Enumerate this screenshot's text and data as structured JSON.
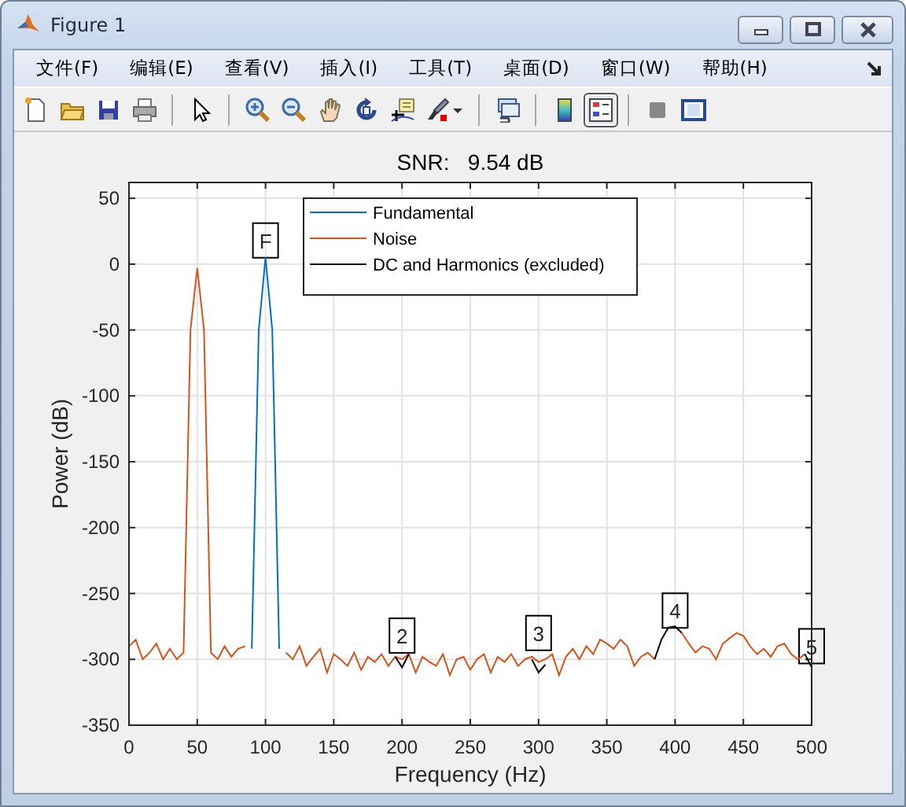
{
  "window": {
    "title": "Figure 1"
  },
  "menu": [
    {
      "label": "文件(F)"
    },
    {
      "label": "编辑(E)"
    },
    {
      "label": "查看(V)"
    },
    {
      "label": "插入(I)"
    },
    {
      "label": "工具(T)"
    },
    {
      "label": "桌面(D)"
    },
    {
      "label": "窗口(W)"
    },
    {
      "label": "帮助(H)"
    }
  ],
  "toolbar": [
    [
      {
        "kind": "new",
        "selected": false
      },
      {
        "kind": "open",
        "selected": false
      },
      {
        "kind": "save",
        "selected": false
      },
      {
        "kind": "print",
        "selected": false
      }
    ],
    [
      {
        "kind": "pointer",
        "selected": false
      }
    ],
    [
      {
        "kind": "zoom-in",
        "selected": false
      },
      {
        "kind": "zoom-out",
        "selected": false
      },
      {
        "kind": "pan",
        "selected": false
      },
      {
        "kind": "rotate",
        "selected": false
      },
      {
        "kind": "datatip",
        "selected": false
      },
      {
        "kind": "brush",
        "selected": false
      }
    ],
    [
      {
        "kind": "link",
        "selected": false
      }
    ],
    [
      {
        "kind": "colorbar",
        "selected": false
      },
      {
        "kind": "legend",
        "selected": true
      }
    ],
    [
      {
        "kind": "hide",
        "selected": false
      },
      {
        "kind": "dock",
        "selected": false
      }
    ]
  ],
  "chart_data": {
    "type": "line",
    "title": "SNR:   9.54 dB",
    "xlabel": "Frequency (Hz)",
    "ylabel": "Power (dB)",
    "xlim": [
      0,
      500
    ],
    "ylim": [
      -350,
      62
    ],
    "grid": true,
    "legend": true,
    "xticks": [
      0,
      50,
      100,
      150,
      200,
      250,
      300,
      350,
      400,
      450,
      500
    ],
    "yticks": [
      -350,
      -300,
      -250,
      -200,
      -150,
      -100,
      -50,
      0,
      50
    ],
    "x": [
      0,
      5,
      10,
      15,
      20,
      25,
      30,
      35,
      40,
      45,
      50,
      55,
      60,
      65,
      70,
      75,
      80,
      85,
      90,
      95,
      100,
      105,
      110,
      115,
      120,
      125,
      130,
      135,
      140,
      145,
      150,
      155,
      160,
      165,
      170,
      175,
      180,
      185,
      190,
      195,
      200,
      205,
      210,
      215,
      220,
      225,
      230,
      235,
      240,
      245,
      250,
      255,
      260,
      265,
      270,
      275,
      280,
      285,
      290,
      295,
      300,
      305,
      310,
      315,
      320,
      325,
      330,
      335,
      340,
      345,
      350,
      355,
      360,
      365,
      370,
      375,
      380,
      385,
      390,
      395,
      400,
      405,
      410,
      415,
      420,
      425,
      430,
      435,
      440,
      445,
      450,
      455,
      460,
      465,
      470,
      475,
      480,
      485,
      490,
      495,
      500
    ],
    "series": [
      {
        "name": "Fundamental",
        "color": "#0072bd",
        "values": [
          null,
          null,
          null,
          null,
          null,
          null,
          null,
          null,
          null,
          null,
          null,
          null,
          null,
          null,
          null,
          null,
          null,
          null,
          -292,
          -50,
          5,
          -50,
          -292,
          null,
          null,
          null,
          null,
          null,
          null,
          null,
          null,
          null,
          null,
          null,
          null,
          null,
          null,
          null,
          null,
          null,
          null,
          null,
          null,
          null,
          null,
          null,
          null,
          null,
          null,
          null,
          null,
          null,
          null,
          null,
          null,
          null,
          null,
          null,
          null,
          null,
          null,
          null,
          null,
          null,
          null,
          null,
          null,
          null,
          null,
          null,
          null,
          null,
          null,
          null,
          null,
          null,
          null,
          null,
          null,
          null,
          null,
          null,
          null,
          null,
          null,
          null,
          null,
          null,
          null,
          null,
          null,
          null,
          null,
          null,
          null,
          null,
          null,
          null,
          null,
          null,
          null
        ]
      },
      {
        "name": "Noise",
        "color": "#d95319",
        "values": [
          -290,
          -285,
          -300,
          -295,
          -288,
          -300,
          -292,
          -300,
          -295,
          -50,
          -3,
          -50,
          -295,
          -300,
          -290,
          -298,
          -292,
          -290,
          null,
          null,
          null,
          null,
          null,
          -295,
          -300,
          -290,
          -305,
          -298,
          -292,
          -310,
          -296,
          -300,
          -305,
          -295,
          -308,
          -298,
          -302,
          -296,
          -305,
          -298,
          -300,
          -296,
          -310,
          -298,
          -302,
          -305,
          -296,
          -312,
          -300,
          -298,
          -308,
          -300,
          -296,
          -310,
          -298,
          -302,
          -296,
          -305,
          -300,
          -298,
          -302,
          -300,
          -296,
          -312,
          -298,
          -292,
          -300,
          -290,
          -296,
          -285,
          -288,
          -292,
          -285,
          -290,
          -305,
          -298,
          -295,
          -300,
          null,
          null,
          null,
          -280,
          -288,
          -295,
          -290,
          -292,
          -300,
          -288,
          -284,
          -280,
          -282,
          -290,
          -296,
          -292,
          -298,
          -290,
          -288,
          -296,
          -300,
          -296,
          null
        ]
      },
      {
        "name": "DC and Harmonics (excluded)",
        "color": "#000000",
        "values": [
          null,
          null,
          null,
          null,
          null,
          null,
          null,
          null,
          null,
          null,
          null,
          null,
          null,
          null,
          null,
          null,
          null,
          null,
          null,
          null,
          null,
          null,
          null,
          null,
          null,
          null,
          null,
          null,
          null,
          null,
          null,
          null,
          null,
          null,
          null,
          null,
          null,
          null,
          null,
          -298,
          -306,
          -296,
          null,
          null,
          null,
          null,
          null,
          null,
          null,
          null,
          null,
          null,
          null,
          null,
          null,
          null,
          null,
          null,
          null,
          -300,
          -310,
          -304,
          null,
          null,
          null,
          null,
          null,
          null,
          null,
          null,
          null,
          null,
          null,
          null,
          null,
          null,
          null,
          -300,
          -285,
          -276,
          -275,
          -280,
          null,
          null,
          null,
          null,
          null,
          null,
          null,
          null,
          null,
          null,
          null,
          null,
          null,
          null,
          null,
          null,
          null,
          -296,
          -306
        ]
      }
    ],
    "annotations": [
      {
        "text": "F",
        "x": 100,
        "y": 18
      },
      {
        "text": "2",
        "x": 200,
        "y": -282
      },
      {
        "text": "3",
        "x": 300,
        "y": -280
      },
      {
        "text": "4",
        "x": 400,
        "y": -263
      },
      {
        "text": "5",
        "x": 500,
        "y": -290
      }
    ]
  }
}
